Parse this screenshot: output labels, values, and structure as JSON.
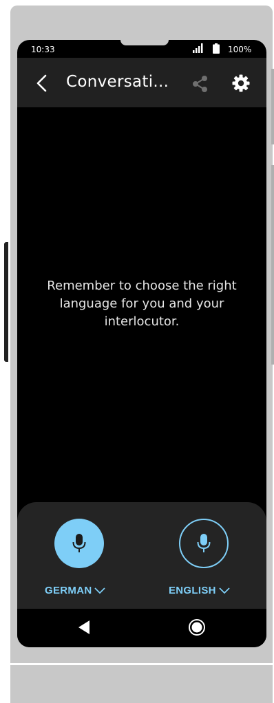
{
  "status_bar": {
    "time": "10:33",
    "battery_percent": "100%",
    "icons": [
      "signal-icon",
      "battery-icon"
    ]
  },
  "app_bar": {
    "title": "Conversati...",
    "icons": [
      "back-arrow-icon",
      "share-icon",
      "settings-gear-icon"
    ]
  },
  "conversation": {
    "message": "Remember to choose the right language for you and your interlocutor."
  },
  "languages": {
    "left": {
      "label": "GERMAN",
      "icon": "microphone-icon",
      "active": true
    },
    "right": {
      "label": "ENGLISH",
      "icon": "microphone-icon",
      "active": false
    }
  },
  "nav_bar": {
    "icons": [
      "nav-back-triangle-icon",
      "nav-home-circle-icon"
    ]
  },
  "colors": {
    "accent": "#7ecef7",
    "app_bar_bg": "#212121",
    "screen_bg": "#000000",
    "panel_bg": "#242424",
    "device_frame": "#c8c8c8"
  }
}
